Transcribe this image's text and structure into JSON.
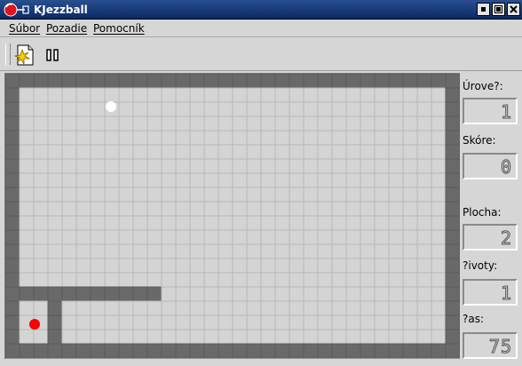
{
  "window": {
    "title": "KJezzball"
  },
  "menubar": {
    "items": [
      {
        "label": "Súbor"
      },
      {
        "label": "Pozadie"
      },
      {
        "label": "Pomocník"
      }
    ]
  },
  "toolbar": {
    "icons": [
      "new-game-icon",
      "pause-icon"
    ]
  },
  "game": {
    "grid_columns": 32,
    "grid_rows": 20,
    "colors": {
      "empty_tile": "#d4d4d4",
      "wall_tile": "#696969",
      "grid_line": "#b8b8b8",
      "white_ball": "#ffffff",
      "red_ball": "#ff0000"
    },
    "balls": [
      {
        "color": "white"
      },
      {
        "color": "red"
      }
    ]
  },
  "status": {
    "level_label": "Úrove?:",
    "level_value": "1",
    "score_label": "Skóre:",
    "score_value": "0",
    "area_label": "Plocha:",
    "area_value": "2",
    "lives_label": "?ivoty:",
    "lives_value": "1",
    "time_label": "?as:",
    "time_value": "75"
  }
}
